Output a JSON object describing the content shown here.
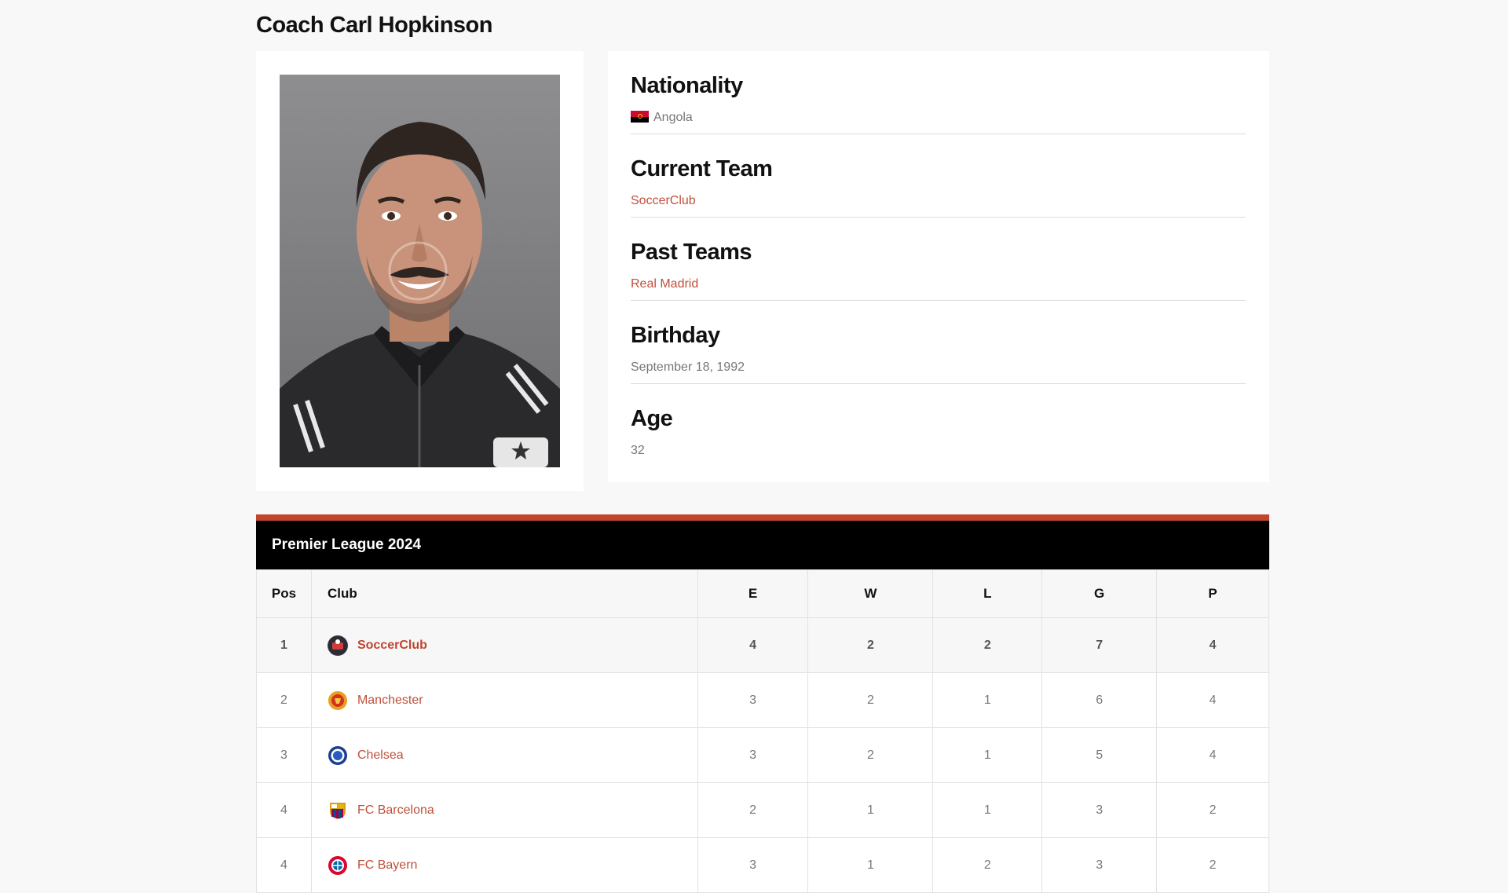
{
  "page_title": "Coach Carl Hopkinson",
  "photo": {
    "alt": "Coach portrait photo"
  },
  "info": {
    "nationality_label": "Nationality",
    "nationality_value": "Angola",
    "nationality_flag_icon": "angola-flag-icon",
    "current_team_label": "Current Team",
    "current_team_value": "SoccerClub",
    "past_teams_label": "Past Teams",
    "past_teams_value": "Real Madrid",
    "birthday_label": "Birthday",
    "birthday_value": "September 18, 1992",
    "age_label": "Age",
    "age_value": "32"
  },
  "league": {
    "title": "Premier League 2024",
    "accent_color": "#c0452f",
    "link_color": "#c0503b",
    "columns": [
      "Pos",
      "Club",
      "E",
      "W",
      "L",
      "G",
      "P"
    ],
    "rows": [
      {
        "pos": "1",
        "club": "SoccerClub",
        "logo_icon": "soccerclub-crest-icon",
        "e": "4",
        "w": "2",
        "l": "2",
        "g": "7",
        "p": "4"
      },
      {
        "pos": "2",
        "club": "Manchester",
        "logo_icon": "manchester-crest-icon",
        "e": "3",
        "w": "2",
        "l": "1",
        "g": "6",
        "p": "4"
      },
      {
        "pos": "3",
        "club": "Chelsea",
        "logo_icon": "chelsea-crest-icon",
        "e": "3",
        "w": "2",
        "l": "1",
        "g": "5",
        "p": "4"
      },
      {
        "pos": "4",
        "club": "FC Barcelona",
        "logo_icon": "barcelona-crest-icon",
        "e": "2",
        "w": "1",
        "l": "1",
        "g": "3",
        "p": "2"
      },
      {
        "pos": "4",
        "club": "FC Bayern",
        "logo_icon": "bayern-crest-icon",
        "e": "3",
        "w": "1",
        "l": "2",
        "g": "3",
        "p": "2"
      }
    ]
  }
}
